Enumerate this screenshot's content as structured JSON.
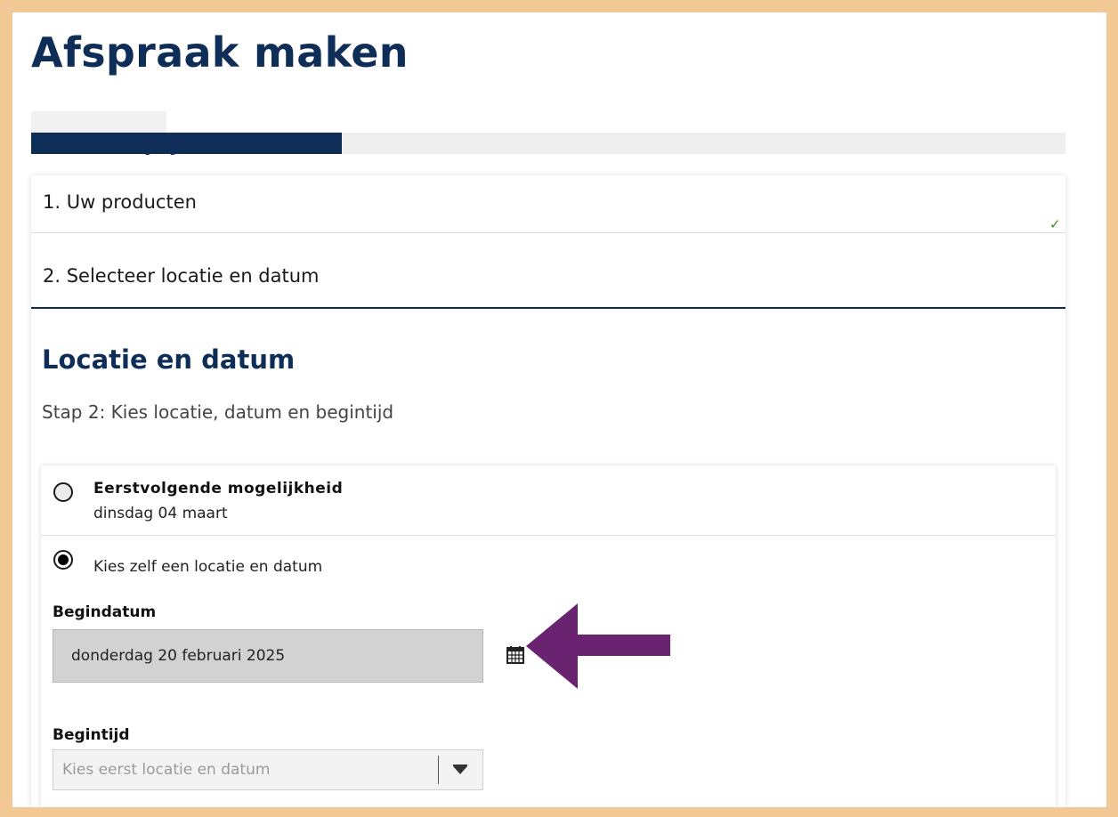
{
  "page": {
    "title": "Afspraak maken"
  },
  "progress": {
    "label": "Voortgang 30%",
    "value_fraction": 0.3,
    "fill_color": "#0e2d57"
  },
  "steps": {
    "step1": {
      "label": "1. Uw producten",
      "status_icon": "check-icon"
    },
    "step2": {
      "label": "2. Selecteer locatie en datum"
    }
  },
  "section": {
    "title": "Locatie en datum",
    "subtitle": "Stap 2: Kies locatie, datum en begintijd"
  },
  "options": {
    "first_available": {
      "title": "Eerstvolgende mogelijkheid",
      "date": "dinsdag 04 maart",
      "selected": false
    },
    "choose_own": {
      "label": "Kies zelf een locatie en datum",
      "selected": true
    }
  },
  "fields": {
    "begindatum": {
      "label": "Begindatum",
      "value": "donderdag 20 februari 2025",
      "icon": "calendar-icon"
    },
    "begintijd": {
      "label": "Begintijd",
      "placeholder": "Kies eerst locatie en datum",
      "icon": "chevron-down-icon"
    }
  },
  "annotation": {
    "icon": "arrow-left-icon",
    "color": "#6a2370"
  },
  "colors": {
    "brand_navy": "#0e2d57",
    "frame_border": "#f2c994",
    "success_green": "#3f8a2a"
  }
}
